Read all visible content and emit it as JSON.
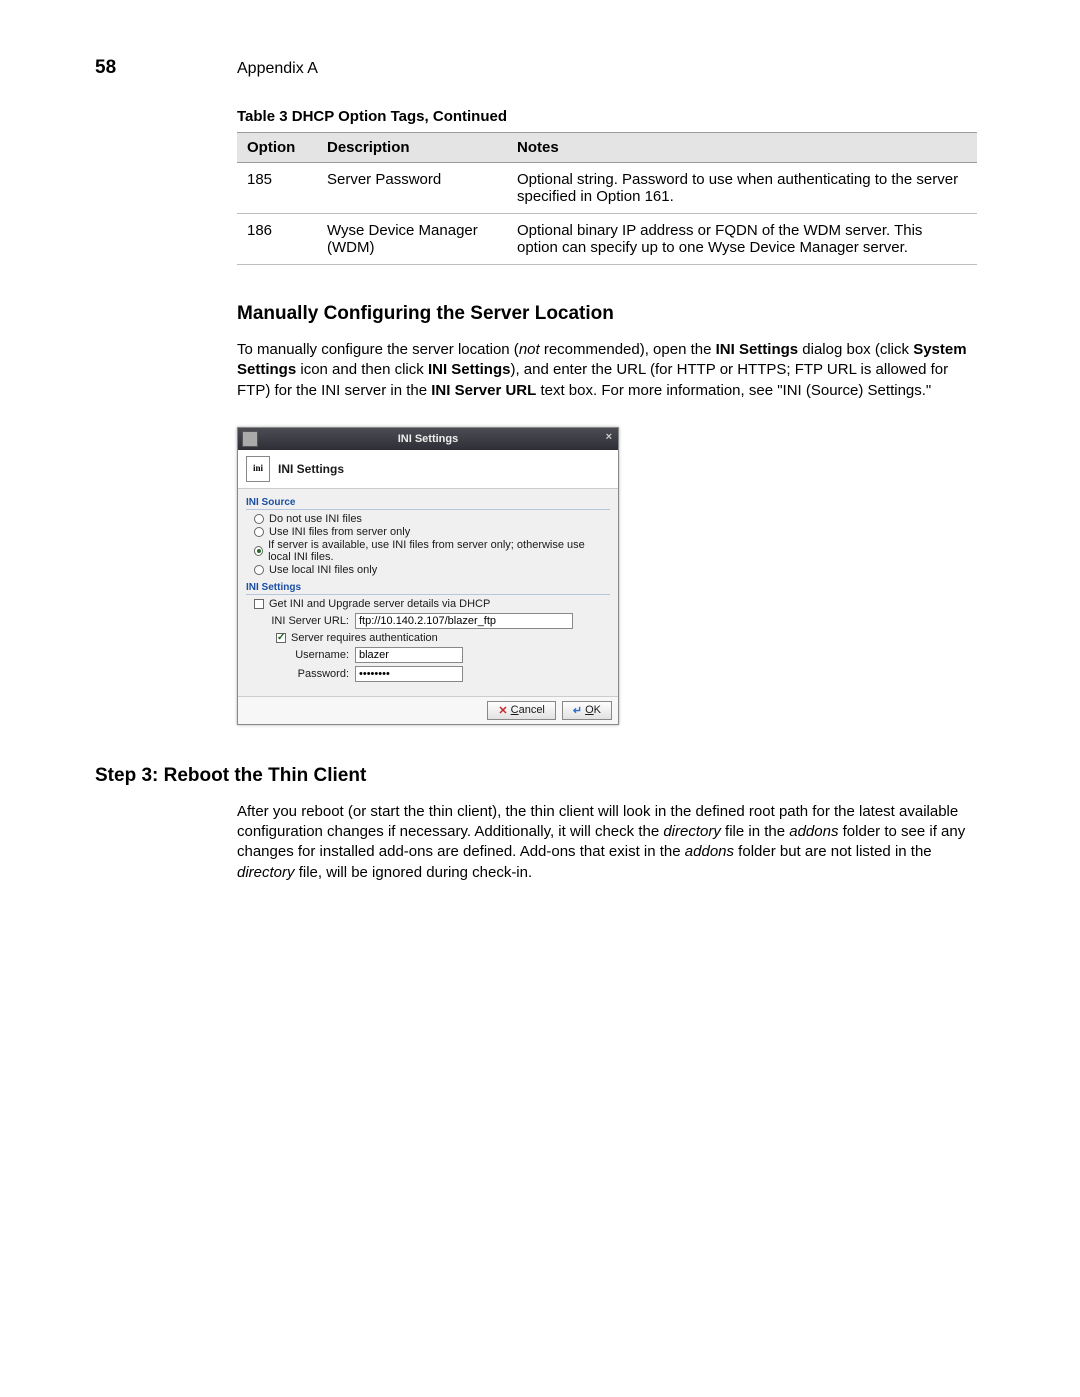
{
  "page_number": "58",
  "appendix": "Appendix A",
  "table": {
    "caption": "Table 3   DHCP Option Tags, Continued",
    "headers": [
      "Option",
      "Description",
      "Notes"
    ],
    "rows": [
      {
        "option": "185",
        "desc": "Server Password",
        "notes": "Optional string. Password to use when authenticating to the server specified in Option 161."
      },
      {
        "option": "186",
        "desc": "Wyse Device Manager (WDM)",
        "notes": "Optional binary IP address or FQDN of the WDM server. This option can specify up to one Wyse Device Manager server."
      }
    ]
  },
  "section1": {
    "title": "Manually Configuring the Server Location",
    "para": {
      "p1": "To manually configure the server location (",
      "not": "not",
      "p2": " recommended), open the ",
      "b1": "INI Settings",
      "p3": " dialog box (click ",
      "b2": "System Settings",
      "p4": " icon and then click ",
      "b3": "INI Settings",
      "p5": "), and enter the URL (for HTTP or HTTPS; FTP URL is allowed for FTP) for the INI server in the ",
      "b4": "INI Server URL",
      "p6": " text box. For more information, see \"INI (Source) Settings.\""
    }
  },
  "dialog": {
    "title": "INI Settings",
    "header": "INI Settings",
    "ini_icon_text": "ini",
    "group_source": "INI Source",
    "source_options": [
      {
        "label": "Do not use INI files",
        "selected": false
      },
      {
        "label": "Use INI files from server only",
        "selected": false
      },
      {
        "label": "If server is available, use INI files from server only; otherwise use local INI files.",
        "selected": true
      },
      {
        "label": "Use local INI files only",
        "selected": false
      }
    ],
    "group_settings": "INI Settings",
    "get_via_dhcp": {
      "label": "Get INI and Upgrade server details via DHCP",
      "checked": false
    },
    "server_url_label": "INI Server URL:",
    "server_url_value": "ftp://10.140.2.107/blazer_ftp",
    "req_auth": {
      "label": "Server requires authentication",
      "checked": true
    },
    "username_label": "Username:",
    "username_value": "blazer",
    "password_label": "Password:",
    "password_value": "••••••••",
    "cancel": "Cancel",
    "ok": "OK"
  },
  "section2": {
    "title": "Step 3: Reboot the Thin Client",
    "para": {
      "p1": "After you reboot (or start the thin client), the thin client will look in the defined root path for the latest available configuration changes if necessary. Additionally, it will check the ",
      "i1": "directory",
      "p2": " file in the ",
      "i2": "addons",
      "p3": " folder to see if any changes for installed add-ons are defined. Add-ons that exist in the ",
      "i3": "addons",
      "p4": " folder but are not listed in the ",
      "i4": "directory",
      "p5": " file, will be ignored during check-in."
    }
  }
}
